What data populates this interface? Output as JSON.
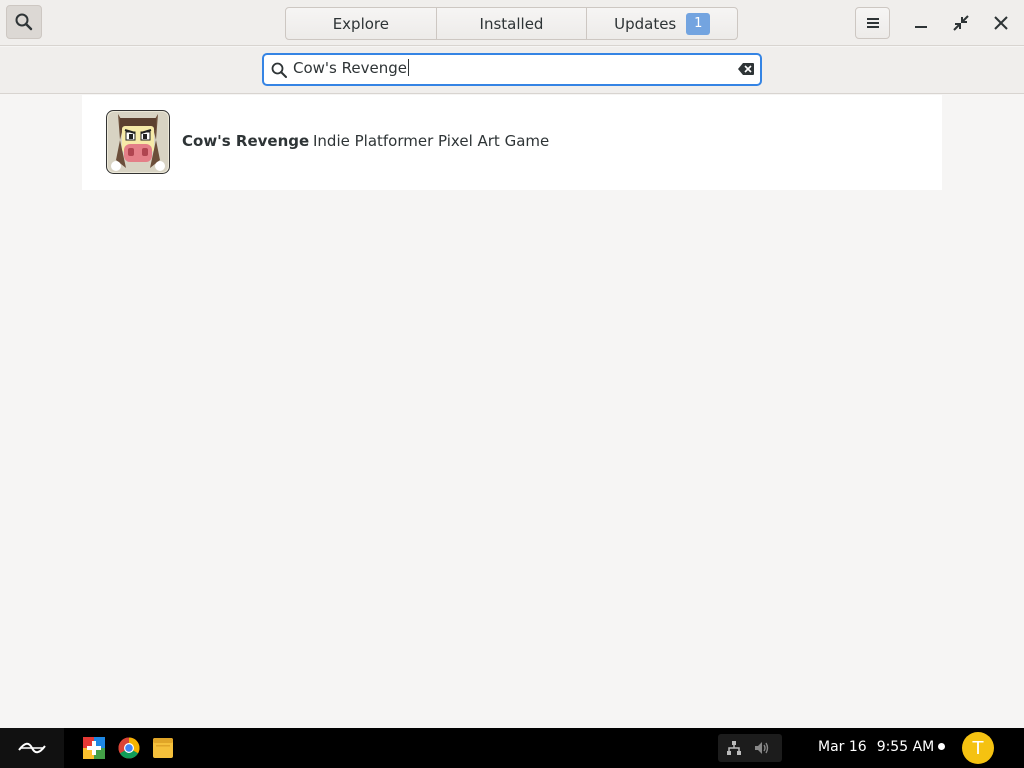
{
  "header": {
    "tabs": [
      {
        "label": "Explore"
      },
      {
        "label": "Installed"
      },
      {
        "label": "Updates",
        "badge": "1"
      }
    ],
    "icons": {
      "search_toggle": "search-icon",
      "menu": "hamburger-menu-icon",
      "minimize": "minimize-icon",
      "restore": "restore-icon",
      "close": "close-icon"
    }
  },
  "search": {
    "value": "Cow's Revenge",
    "icon": "search-icon",
    "clear_icon": "clear-icon"
  },
  "results": [
    {
      "name": "Cow's Revenge",
      "summary": "Indie Platformer Pixel Art Game",
      "icon": "cows-revenge-app-icon"
    }
  ],
  "taskbar": {
    "apps": [
      "app-center-icon",
      "chrome-icon",
      "files-icon"
    ],
    "date": "Mar 16",
    "time": "9:55 AM",
    "user_initial": "T"
  },
  "colors": {
    "accent": "#3584e4",
    "badge": "#73a4e0",
    "avatar": "#f5c211"
  }
}
